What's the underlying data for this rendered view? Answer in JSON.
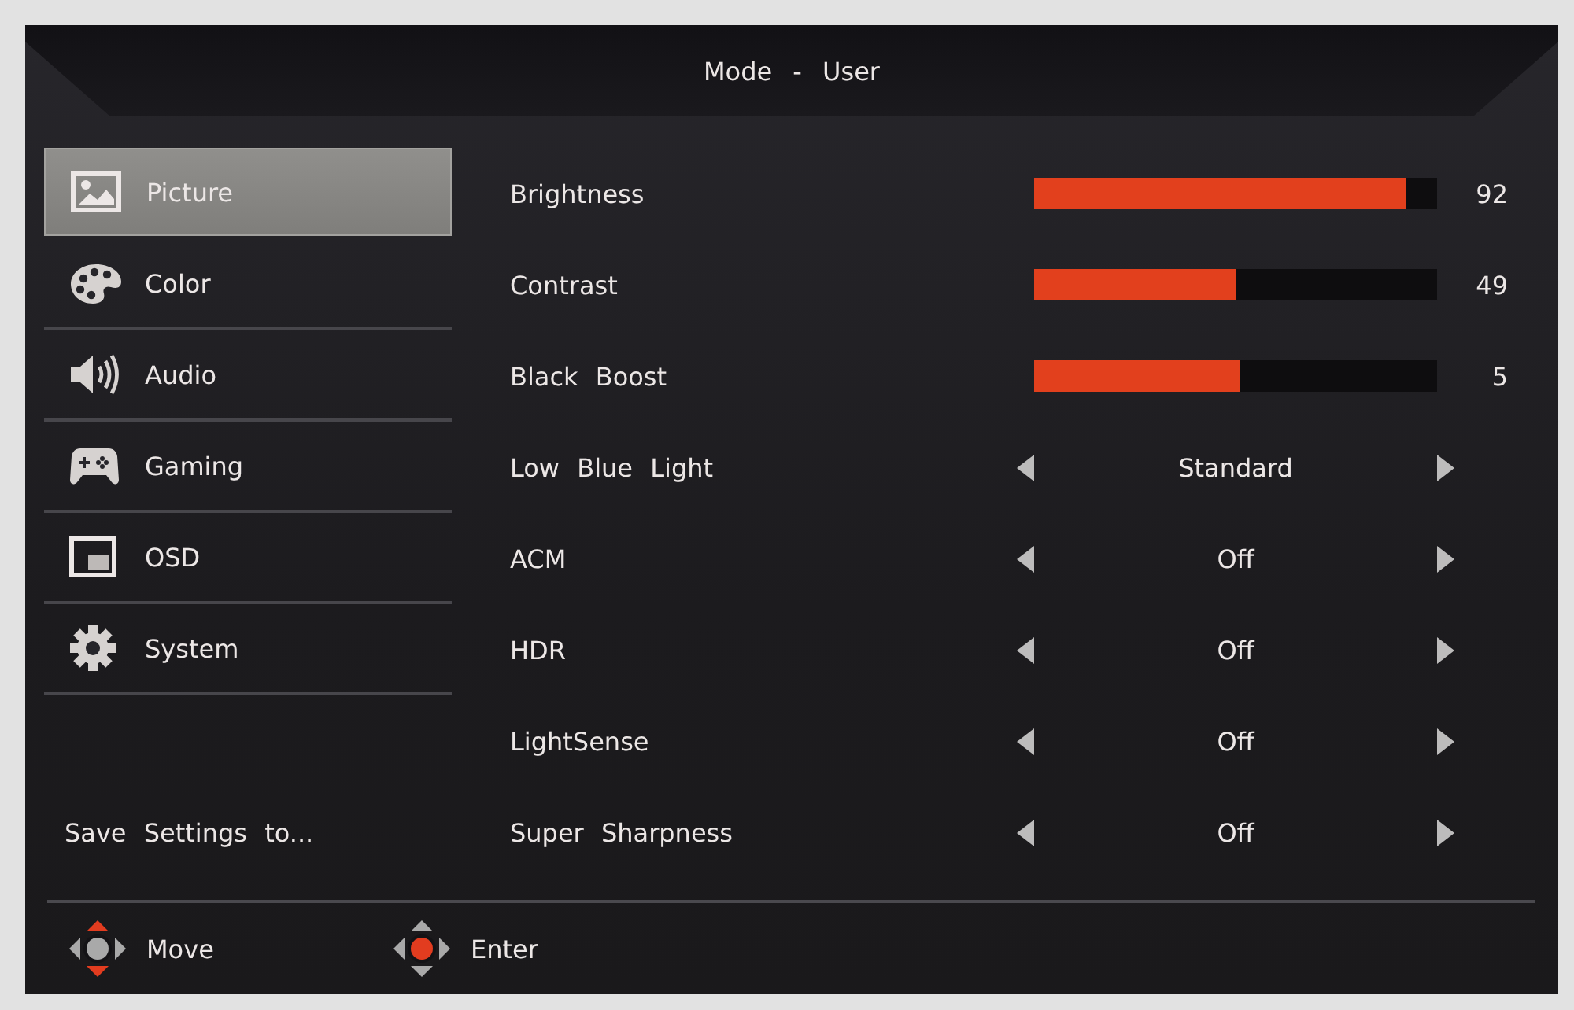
{
  "header": {
    "title": "Mode - User"
  },
  "sidebar": {
    "items": [
      {
        "label": "Picture",
        "selected": true
      },
      {
        "label": "Color",
        "selected": false
      },
      {
        "label": "Audio",
        "selected": false
      },
      {
        "label": "Gaming",
        "selected": false
      },
      {
        "label": "OSD",
        "selected": false
      },
      {
        "label": "System",
        "selected": false
      }
    ],
    "save_label": "Save Settings to..."
  },
  "settings": [
    {
      "kind": "slider",
      "label": "Brightness",
      "level": 0.92,
      "reading": "92"
    },
    {
      "kind": "slider",
      "label": "Contrast",
      "level": 0.5,
      "reading": "49"
    },
    {
      "kind": "slider",
      "label": "Black Boost",
      "level": 0.51,
      "reading": "5"
    },
    {
      "kind": "selector",
      "label": "Low Blue Light",
      "value": "Standard"
    },
    {
      "kind": "selector",
      "label": "ACM",
      "value": "Off"
    },
    {
      "kind": "selector",
      "label": "HDR",
      "value": "Off"
    },
    {
      "kind": "selector",
      "label": "LightSense",
      "value": "Off"
    },
    {
      "kind": "selector",
      "label": "Super Sharpness",
      "value": "Off"
    }
  ],
  "footer": {
    "hints": [
      {
        "label": "Move"
      },
      {
        "label": "Enter"
      }
    ]
  }
}
